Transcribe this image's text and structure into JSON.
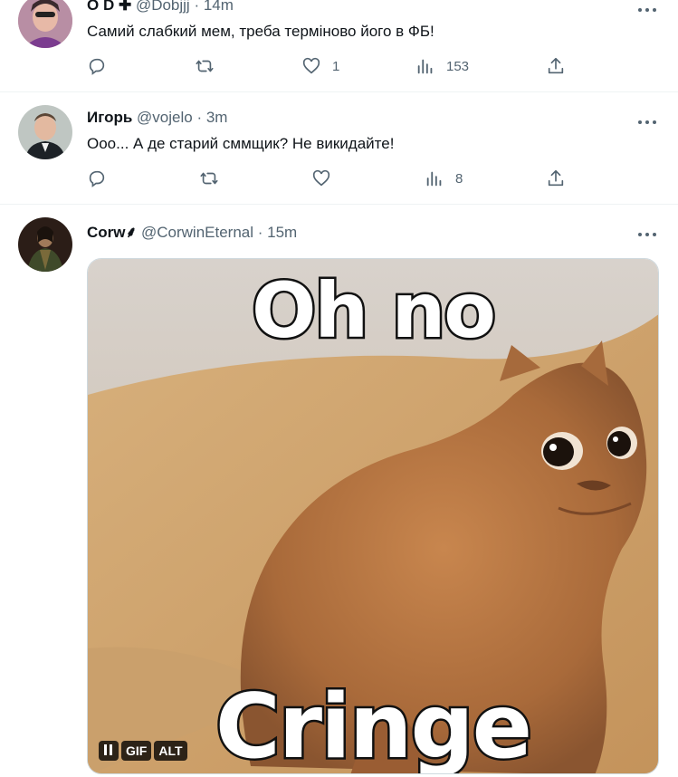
{
  "tweets": [
    {
      "name": "O D ✚",
      "handle": "@Dobjjj",
      "time": "· 14m",
      "text": "Самий слабкий мем, треба терміново його в ФБ!",
      "likes": "1",
      "views": "153"
    },
    {
      "name": "Игорь",
      "handle": "@vojelo",
      "time": "· 3m",
      "text": "Ооо... А де старий сммщик? Не викидайте!",
      "likes": "",
      "views": "8"
    },
    {
      "name": "Corw⸙",
      "handle": "@CorwinEternal",
      "time": "· 15m",
      "media": {
        "caption_top": "Oh no",
        "caption_bottom": "Cringe",
        "badge_gif": "GIF",
        "badge_alt": "ALT"
      }
    }
  ],
  "colors": {
    "text": "#0f1419",
    "secondary": "#536471",
    "divider": "#eff3f4"
  },
  "icons": [
    "reply-icon",
    "retweet-icon",
    "like-icon",
    "views-icon",
    "share-icon",
    "more-icon",
    "pause-icon"
  ]
}
